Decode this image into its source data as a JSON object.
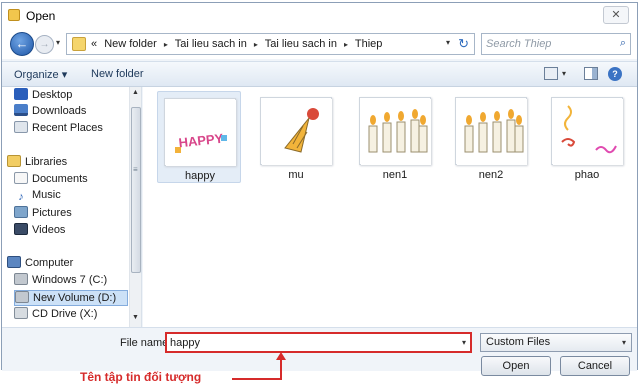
{
  "window": {
    "title": "Open",
    "close_glyph": "✕"
  },
  "nav": {
    "back_glyph": "←",
    "forward_glyph": "→",
    "recent_glyph": "▾",
    "address_prefix": "«",
    "breadcrumbs": [
      "New folder",
      "Tai lieu sach in",
      "Tai lieu sach in",
      "Thiep"
    ],
    "crumb_separator": "▸",
    "address_dropdown_glyph": "▾",
    "refresh_glyph": "↻",
    "search_placeholder": "Search Thiep",
    "search_glyph": "⌕"
  },
  "toolbar": {
    "organize_label": "Organize ▾",
    "new_folder_label": "New folder",
    "views_dropdown_glyph": "▾",
    "help_glyph": "?"
  },
  "sidebar": {
    "items": [
      {
        "label": "Desktop",
        "icon": "desktop-icon"
      },
      {
        "label": "Downloads",
        "icon": "downloads-icon"
      },
      {
        "label": "Recent Places",
        "icon": "recent-places-icon"
      },
      {
        "label": "Libraries",
        "icon": "libraries-icon"
      },
      {
        "label": "Documents",
        "icon": "documents-icon"
      },
      {
        "label": "Music",
        "icon": "music-icon"
      },
      {
        "label": "Pictures",
        "icon": "pictures-icon"
      },
      {
        "label": "Videos",
        "icon": "videos-icon"
      },
      {
        "label": "Computer",
        "icon": "computer-icon"
      },
      {
        "label": "Windows 7 (C:)",
        "icon": "drive-icon"
      },
      {
        "label": "New Volume (D:)",
        "icon": "drive-icon",
        "selected": true
      },
      {
        "label": "CD Drive (X:)",
        "icon": "cd-drive-icon"
      }
    ],
    "music_glyph": "♪",
    "scroll_up_glyph": "▲",
    "scroll_down_glyph": "▼",
    "scroll_grip_glyph": "≡"
  },
  "files": [
    {
      "name": "happy",
      "thumbnail": "happy-text-candles",
      "selected": true,
      "thumb_text": "HAPPY"
    },
    {
      "name": "mu",
      "thumbnail": "party-hat"
    },
    {
      "name": "nen1",
      "thumbnail": "birthday-candles"
    },
    {
      "name": "nen2",
      "thumbnail": "birthday-candles"
    },
    {
      "name": "phao",
      "thumbnail": "streamers"
    }
  ],
  "bottom": {
    "file_name_label": "File name:",
    "file_name_value": "happy",
    "file_name_dropdown_glyph": "▾",
    "file_type": "Custom Files",
    "file_type_dropdown_glyph": "▾",
    "open_button": "Open",
    "cancel_button": "Cancel"
  },
  "annotation": {
    "text": "Tên tập tin đối tượng",
    "color": "#d62b2b"
  },
  "colors": {
    "accent_blue": "#3b73c4",
    "selection_bg": "#cce1f7",
    "highlight_red": "#d62b2b"
  }
}
